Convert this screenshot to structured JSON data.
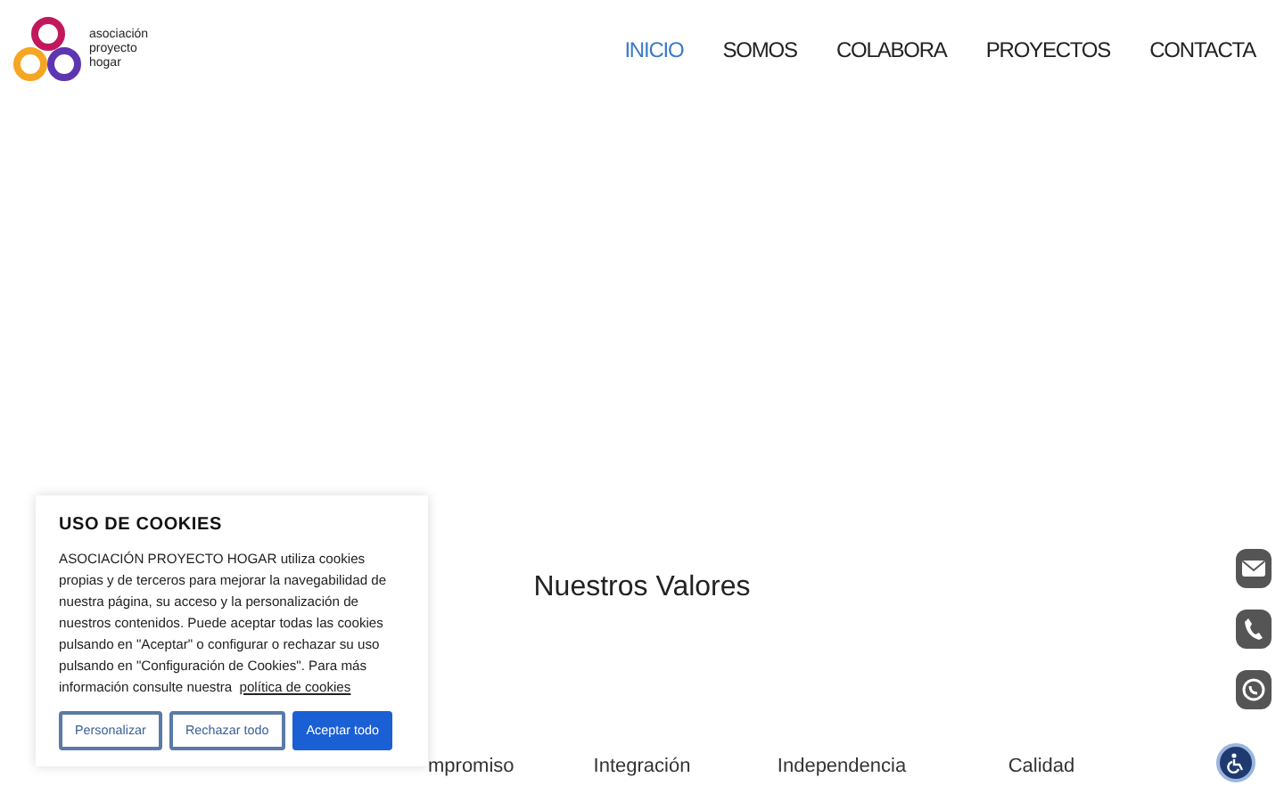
{
  "logo": {
    "text": "asociación proyecto hogar"
  },
  "nav": [
    {
      "label": "INICIO",
      "selected": true
    },
    {
      "label": "SOMOS",
      "selected": false
    },
    {
      "label": "COLABORA",
      "selected": false
    },
    {
      "label": "PROYECTOS",
      "selected": false
    },
    {
      "label": "CONTACTA",
      "selected": false
    }
  ],
  "values_section": {
    "title": "Nuestros Valores",
    "values": [
      "mpromiso",
      "Integración",
      "Independencia",
      "Calidad"
    ]
  },
  "cookie_banner": {
    "title": "USO DE COOKIES",
    "text": "ASOCIACIÓN PROYECTO HOGAR utiliza cookies propias y de terceros para mejorar la navegabilidad de nuestra página, su acceso y la personalización de nuestros contenidos. Puede aceptar todas las cookies pulsando en \"Aceptar\" o configurar o rechazar su uso pulsando en \"Configuración de Cookies\". Para más información consulte nuestra",
    "link": "política de cookies",
    "buttons": [
      {
        "label": "Personalizar",
        "kind": "outline"
      },
      {
        "label": "Rechazar todo",
        "kind": "outline"
      },
      {
        "label": "Aceptar todo",
        "kind": "primary"
      }
    ]
  }
}
